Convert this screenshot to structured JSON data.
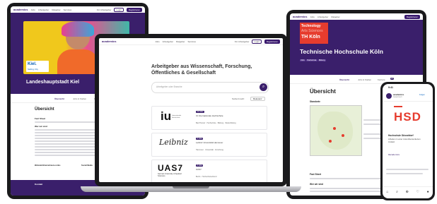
{
  "brand": {
    "logo": "academics",
    "primary": "#3a1f6b",
    "accent": "#e63c2e"
  },
  "nav": {
    "items": [
      "Jobs",
      "Arbeitgeber",
      "Ratgeber",
      "Services"
    ],
    "employer_btn": "Für Arbeitgeber",
    "login_btn": "Login",
    "register_btn": "Registrieren"
  },
  "tablet_left": {
    "employer": "Landeshauptstadt Kiel",
    "logo_text": "Kiel.",
    "logo_sub": "Sailing.City",
    "tabs": [
      "Übersicht",
      "Jobs & Stellen",
      "Karriere"
    ],
    "section_title": "Übersicht",
    "fact_sheet": "Fact Sheet",
    "about": "Wer wir sind",
    "website_label": "Website/Unternehmens-Links",
    "social_label": "Social Media",
    "footer_title": "Kontakt"
  },
  "laptop": {
    "headline": "Arbeitgeber aus Wissenschaft, Forschung, Öffentliches & Gesellschaft",
    "search_placeholder": "Arbeitgeber oder Branche",
    "sort_label": "Sortiert nach:",
    "sort_value": "Relevanz",
    "cards": [
      {
        "logo": "iu",
        "logo_sub": "Internationale Hochschule",
        "badge": "12 Jobs",
        "name": "IU Internationale Hochschule",
        "tags": [
          "Bad Honnef",
          "Hochschule",
          "Bildung",
          "Weiterbildung"
        ]
      },
      {
        "logo": "Leibniz",
        "logo_sub": "",
        "badge": "5 Jobs",
        "name": "Leibniz Universität Hannover",
        "tags": [
          "Hannover",
          "Universität",
          "Forschung"
        ]
      },
      {
        "logo": "UAS7",
        "logo_sub": "German University of Applied Sciences",
        "badge": "3 Jobs",
        "name": "UAS7",
        "tags": [
          "Berlin",
          "Hochschulverbund"
        ]
      }
    ]
  },
  "tablet_right": {
    "logo_line1": "Technology",
    "logo_line2": "Arts Sciences",
    "logo_line3": "TH Köln",
    "employer": "Technische Hochschule Köln",
    "badges": [
      "Köln",
      "Hochschule",
      "Bildung"
    ],
    "tabs": [
      "Übersicht",
      "Jobs & Stellen",
      "Karriere"
    ],
    "tab_count": "23",
    "section_title": "Übersicht",
    "standorte": "Standorte",
    "fact_sheet": "Fact Sheet",
    "about": "Wer wir sind"
  },
  "phone": {
    "time": "9:41",
    "account": "academics",
    "account_sub": "Gesponsert",
    "follow": "Folgen",
    "logo": "HSD",
    "org_name": "Hochschule Düsseldorf",
    "caption": "Arbeiten in einer zukunftsorientierten Umfeld",
    "hashtag": "#academics"
  }
}
